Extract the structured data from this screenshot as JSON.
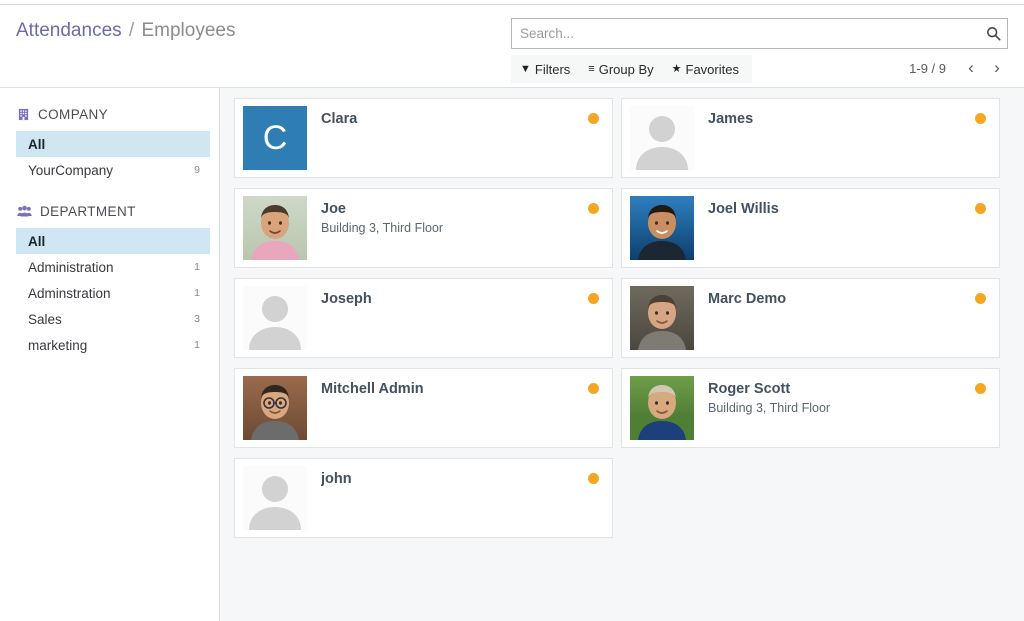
{
  "breadcrumb": {
    "parent": "Attendances",
    "separator": "/",
    "current": "Employees"
  },
  "search": {
    "placeholder": "Search...",
    "value": "",
    "icon": "search-icon"
  },
  "filter_bar": {
    "filters_label": "Filters",
    "filters_icon": "▼",
    "group_by_label": "Group By",
    "group_by_icon": "≡",
    "favorites_label": "Favorites",
    "favorites_icon": "★"
  },
  "pager": {
    "range": "1-9 / 9",
    "prev_icon": "‹",
    "next_icon": "›"
  },
  "sidebar": {
    "sections": [
      {
        "title": "COMPANY",
        "icon": "building-icon",
        "items": [
          {
            "label": "All",
            "count": "",
            "selected": true
          },
          {
            "label": "YourCompany",
            "count": "9",
            "selected": false
          }
        ]
      },
      {
        "title": "DEPARTMENT",
        "icon": "users-icon",
        "items": [
          {
            "label": "All",
            "count": "",
            "selected": true
          },
          {
            "label": "Administration",
            "count": "1",
            "selected": false
          },
          {
            "label": "Adminstration",
            "count": "1",
            "selected": false
          },
          {
            "label": "Sales",
            "count": "3",
            "selected": false
          },
          {
            "label": "marketing",
            "count": "1",
            "selected": false
          }
        ]
      }
    ]
  },
  "colors": {
    "status_dot": "#f5a623",
    "sidebar_selected": "#cfe7f3",
    "breadcrumb_link": "#6a6ca8",
    "clara_avatar_bg": "#2f7eb3"
  },
  "kanban": {
    "cards": [
      {
        "name": "Clara",
        "subtitle": "",
        "status": "present",
        "avatar": "letter-tile",
        "letter": "C",
        "avatar_bg": "#2f7eb3"
      },
      {
        "name": "James",
        "subtitle": "",
        "status": "present",
        "avatar": "placeholder-silhouette"
      },
      {
        "name": "Joe",
        "subtitle": "Building 3, Third Floor",
        "status": "present",
        "avatar": "photo-joe"
      },
      {
        "name": "Joel Willis",
        "subtitle": "",
        "status": "present",
        "avatar": "photo-joel-willis"
      },
      {
        "name": "Joseph",
        "subtitle": "",
        "status": "present",
        "avatar": "placeholder-silhouette"
      },
      {
        "name": "Marc Demo",
        "subtitle": "",
        "status": "present",
        "avatar": "photo-marc-demo"
      },
      {
        "name": "Mitchell Admin",
        "subtitle": "",
        "status": "present",
        "avatar": "photo-mitchell-admin"
      },
      {
        "name": "Roger Scott",
        "subtitle": "Building 3, Third Floor",
        "status": "present",
        "avatar": "photo-roger-scott"
      },
      {
        "name": "john",
        "subtitle": "",
        "status": "present",
        "avatar": "placeholder-silhouette"
      }
    ]
  }
}
